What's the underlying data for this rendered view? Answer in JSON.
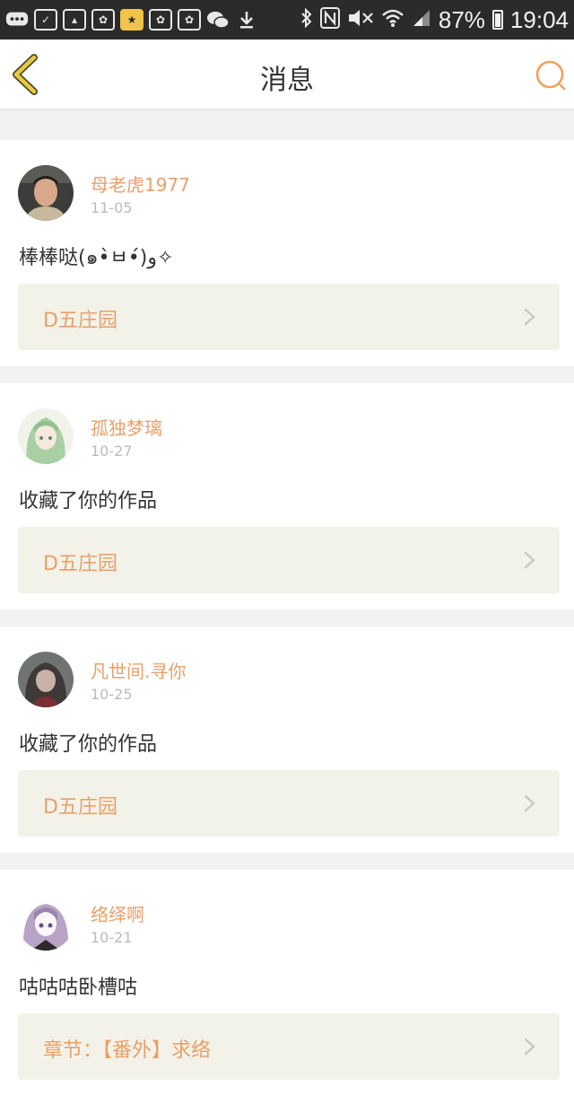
{
  "status_bar": {
    "battery": "87%",
    "time": "19:04"
  },
  "header": {
    "title": "消息"
  },
  "messages": [
    {
      "username": "母老虎1977",
      "date": "11-05",
      "text": "棒棒哒(๑•̀ㅂ•́)و✧",
      "work": "D五庄园"
    },
    {
      "username": "孤独梦璃",
      "date": "10-27",
      "text": "收藏了你的作品",
      "work": "D五庄园"
    },
    {
      "username": "凡世间.寻你",
      "date": "10-25",
      "text": "收藏了你的作品",
      "work": "D五庄园"
    },
    {
      "username": "络绎啊",
      "date": "10-21",
      "text": "咕咕咕卧槽咕",
      "work": "章节：【番外】求络"
    }
  ],
  "colors": {
    "accent": "#e8a06a",
    "link_bg": "#f3f2e8",
    "back_arrow": "#e8c840"
  }
}
